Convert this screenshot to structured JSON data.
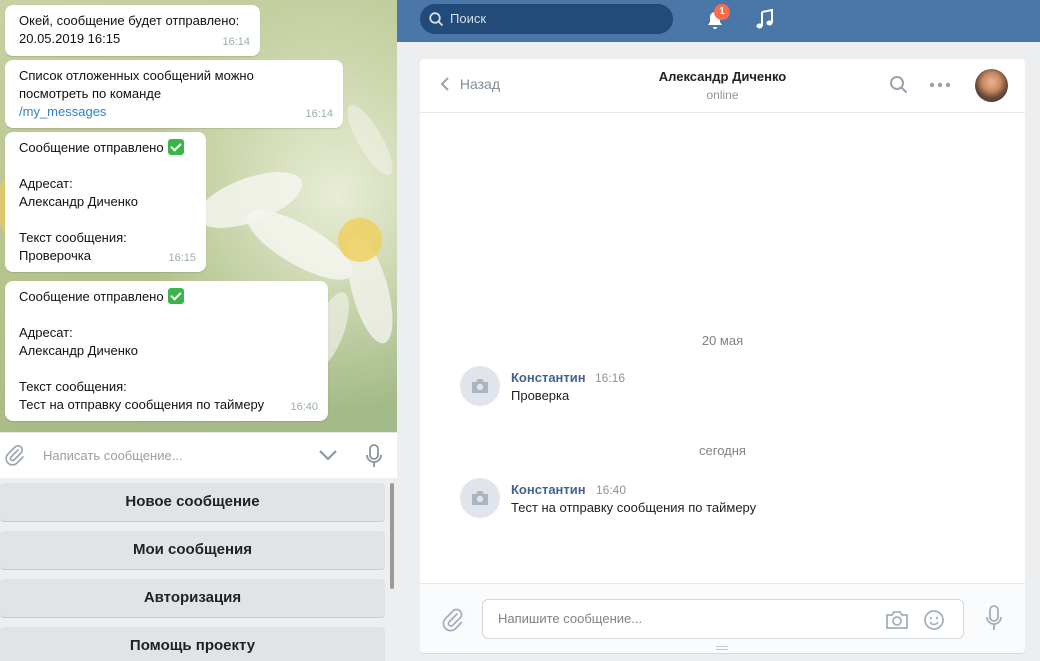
{
  "telegram": {
    "messages": [
      {
        "text": "Окей, сообщение будет отправлено:\n20.05.2019 16:15",
        "time": "16:14"
      },
      {
        "text": "Список отложенных сообщений можно\nпосмотреть по команде",
        "link": "/my_messages",
        "time": "16:14"
      },
      {
        "head": "Сообщение отправлено",
        "text": "Адресат:\nАлександр Диченко\n\nТекст сообщения:\nПроверочка",
        "time": "16:15"
      },
      {
        "head": "Сообщение отправлено",
        "text": "Адресат:\nАлександр Диченко\n\nТекст сообщения:\nТест на отправку сообщения по таймеру",
        "time": "16:40"
      }
    ],
    "input": {
      "placeholder": "Написать сообщение..."
    },
    "keyboard": [
      "Новое сообщение",
      "Мои сообщения",
      "Авторизация",
      "Помощь проекту"
    ]
  },
  "vk": {
    "search": {
      "placeholder": "Поиск"
    },
    "notifications": {
      "count": "1"
    },
    "header": {
      "back": "Назад",
      "name": "Александр Диченко",
      "status": "online"
    },
    "dates": [
      "20 мая",
      "сегодня"
    ],
    "messages": [
      {
        "author": "Константин",
        "time": "16:16",
        "text": "Проверка"
      },
      {
        "author": "Константин",
        "time": "16:40",
        "text": "Тест на отправку сообщения по таймеру"
      }
    ],
    "composer": {
      "placeholder": "Напишите сообщение..."
    },
    "colors": {
      "topbar": "#4a76a8",
      "link": "#42648b",
      "accent": "#2f80c8"
    }
  }
}
